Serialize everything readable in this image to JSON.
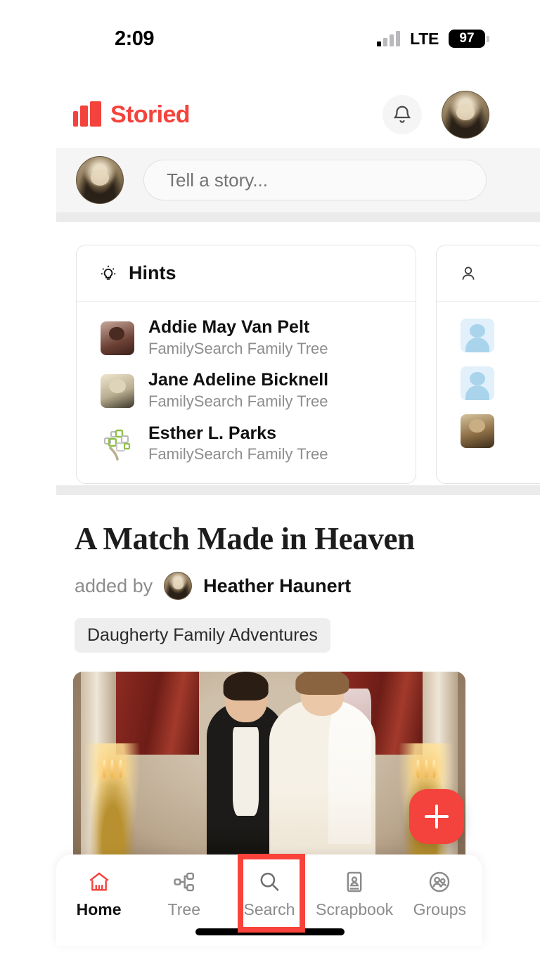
{
  "status_bar": {
    "time": "2:09",
    "network": "LTE",
    "battery": "97",
    "signal_icon": "signal-bars-icon",
    "battery_icon": "battery-icon"
  },
  "header": {
    "brand": "Storied",
    "logo_icon": "storied-bars-logo-icon",
    "brand_color": "#F4423C",
    "notifications_icon": "bell-icon",
    "avatar_icon": "user-avatar"
  },
  "composer": {
    "placeholder": "Tell a story...",
    "avatar_icon": "user-avatar"
  },
  "cards": [
    {
      "title": "Hints",
      "icon": "lightbulb-icon",
      "items": [
        {
          "name": "Addie May Van Pelt",
          "source": "FamilySearch Family Tree",
          "thumb": "portrait-photo"
        },
        {
          "name": "Jane Adeline Bicknell",
          "source": "FamilySearch Family Tree",
          "thumb": "portrait-photo"
        },
        {
          "name": "Esther L. Parks",
          "source": "FamilySearch Family Tree",
          "thumb": "familysearch-tree-logo-icon"
        }
      ]
    },
    {
      "title": "",
      "icon": "person-icon",
      "items": [
        {
          "name": "",
          "source": "",
          "thumb": "placeholder-avatar"
        },
        {
          "name": "",
          "source": "",
          "thumb": "placeholder-avatar"
        },
        {
          "name": "",
          "source": "",
          "thumb": "portrait-photo"
        }
      ]
    }
  ],
  "story": {
    "title": "A Match Made in Heaven",
    "added_by_label": "added by",
    "author": "Heather Haunert",
    "author_avatar_icon": "user-avatar",
    "tag": "Daugherty Family Adventures",
    "image_alt": "victorian-wedding-portrait"
  },
  "fab": {
    "label": "+",
    "icon": "plus-icon",
    "color": "#F4423C"
  },
  "tabbar": {
    "active": "Home",
    "items": [
      {
        "label": "Home",
        "icon": "home-icon"
      },
      {
        "label": "Tree",
        "icon": "tree-icon"
      },
      {
        "label": "Search",
        "icon": "search-icon"
      },
      {
        "label": "Scrapbook",
        "icon": "scrapbook-icon"
      },
      {
        "label": "Groups",
        "icon": "groups-icon"
      }
    ]
  },
  "annotation": {
    "target": "Search",
    "color": "#F9423A"
  }
}
